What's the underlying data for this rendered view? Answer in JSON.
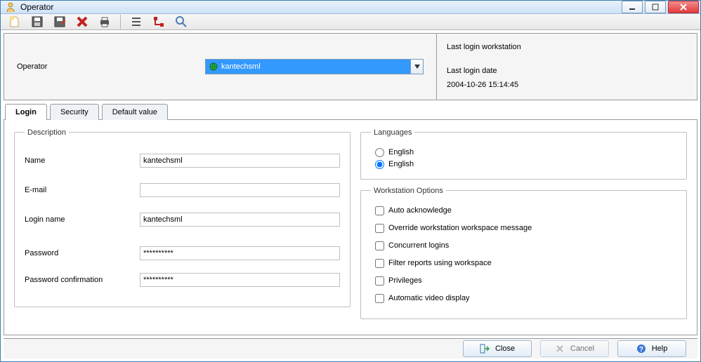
{
  "titlebar": {
    "title": "Operator"
  },
  "header": {
    "operator_label": "Operator",
    "operator_value": "kantechsml",
    "last_login_workstation_label": "Last login workstation",
    "last_login_workstation_value": "",
    "last_login_date_label": "Last login date",
    "last_login_date_value": "2004-10-26 15:14:45"
  },
  "tabs": {
    "login": "Login",
    "security": "Security",
    "default_value": "Default value"
  },
  "description": {
    "legend": "Description",
    "name_label": "Name",
    "name_value": "kantechsml",
    "email_label": "E-mail",
    "email_value": "",
    "login_name_label": "Login name",
    "login_name_value": "kantechsml",
    "password_label": "Password",
    "password_value": "**********",
    "password_confirm_label": "Password confirmation",
    "password_confirm_value": "**********"
  },
  "languages": {
    "legend": "Languages",
    "option1": "English",
    "option2": "English"
  },
  "workstation": {
    "legend": "Workstation Options",
    "auto_ack": "Auto acknowledge",
    "override_msg": "Override workstation workspace message",
    "concurrent": "Concurrent logins",
    "filter_reports": "Filter reports using workspace",
    "privileges": "Privileges",
    "auto_video": "Automatic video display"
  },
  "buttons": {
    "close": "Close",
    "cancel": "Cancel",
    "help": "Help"
  }
}
